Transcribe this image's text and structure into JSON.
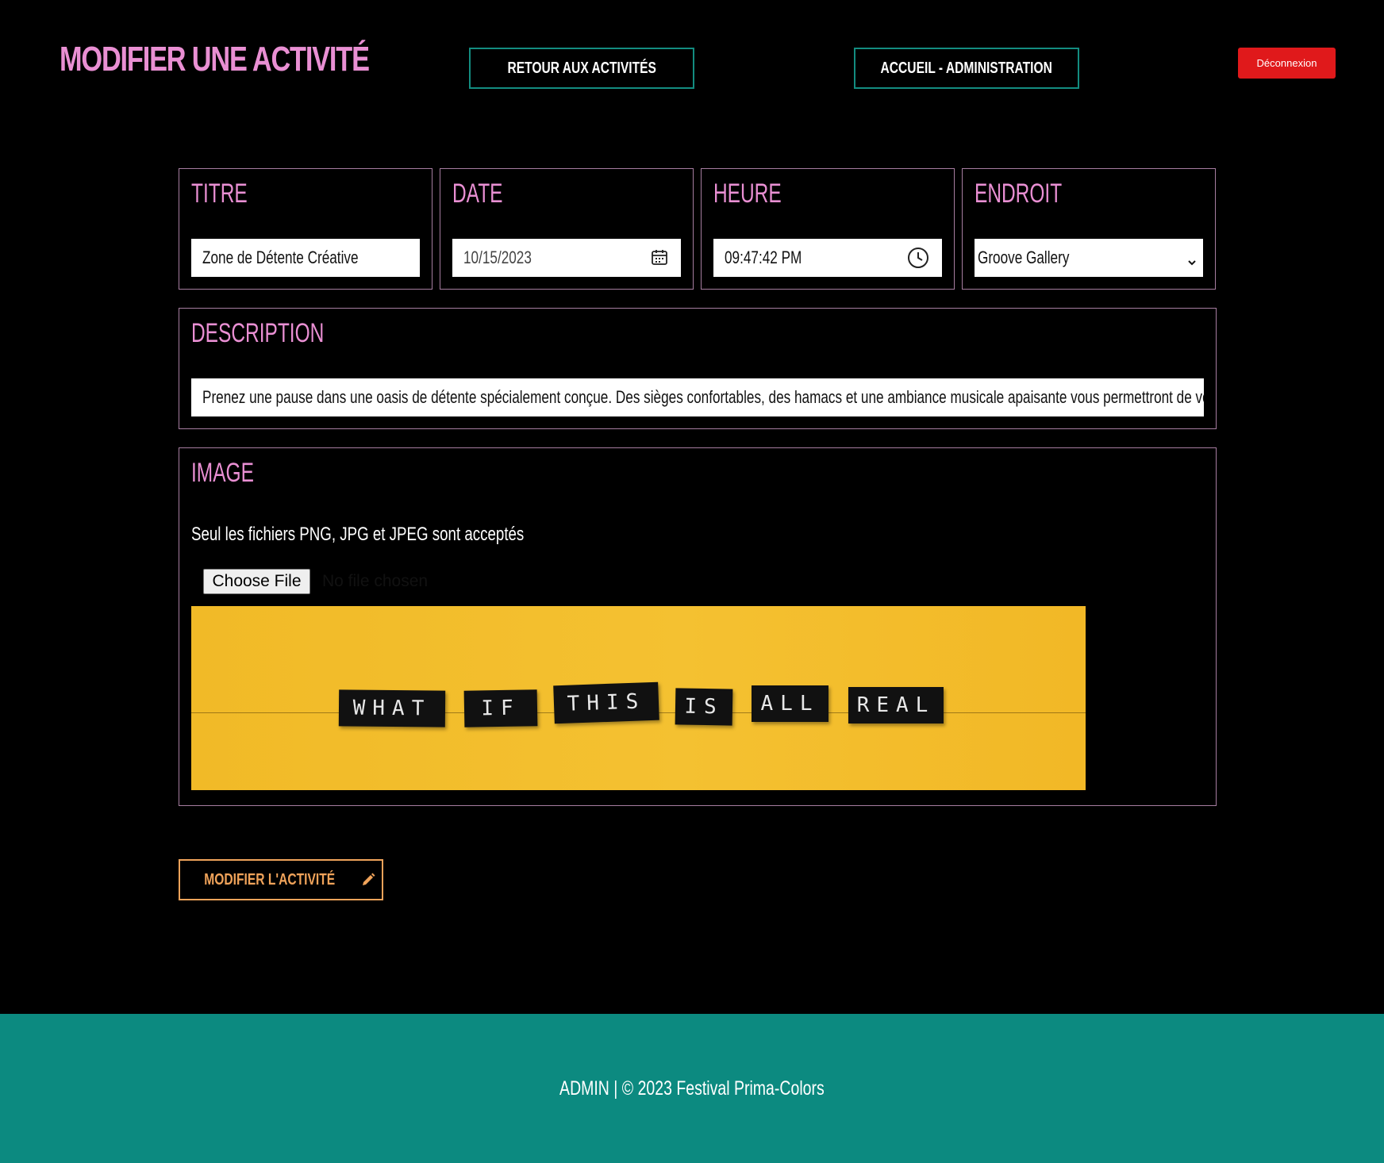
{
  "header": {
    "title": "MODIFIER UNE ACTIVITÉ",
    "back_label": "RETOUR AUX ACTIVITÉS",
    "home_label": "ACCUEIL - ADMINISTRATION",
    "logout_label": "Déconnexion"
  },
  "form": {
    "title": {
      "label": "TITRE",
      "value": "Zone de Détente Créative"
    },
    "date": {
      "label": "DATE",
      "value": "10/15/2023",
      "icon": "calendar-icon"
    },
    "time": {
      "label": "HEURE",
      "value": "09:47:42 PM",
      "icon": "clock-icon"
    },
    "location": {
      "label": "ENDROIT",
      "value": "Groove Gallery",
      "icon": "chevron-down-icon"
    },
    "description": {
      "label": "DESCRIPTION",
      "value": "Prenez une pause dans une oasis de détente spécialement conçue. Des sièges confortables, des hamacs et une ambiance musicale apaisante vous permettront de vous re"
    },
    "image": {
      "label": "IMAGE",
      "hint": "Seul les fichiers PNG, JPG et JPEG sont acceptés",
      "file_button": "Choose File",
      "file_status": "No file chosen",
      "preview_words": [
        "WHAT",
        "IF",
        "THIS",
        "IS",
        "ALL",
        "REAL"
      ]
    },
    "submit_label": "MODIFIER L'ACTIVITÉ",
    "submit_icon": "pencil-icon"
  },
  "footer": {
    "text": "ADMIN | © 2023 Festival Prima-Colors"
  },
  "colors": {
    "background": "#000000",
    "accent_pink": "#e98fd3",
    "accent_teal": "#138c80",
    "footer_teal": "#0c8a80",
    "logout_red": "#e0191b",
    "submit_orange": "#f0a35a",
    "image_yellow": "#f3bd2c"
  }
}
